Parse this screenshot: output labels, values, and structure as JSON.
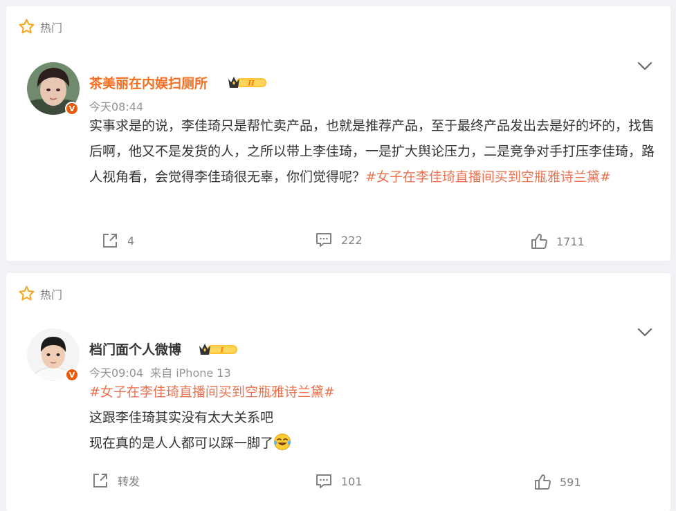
{
  "posts": [
    {
      "hot_label": "热门",
      "author": "茶美丽在内娱扫厕所",
      "level": "II",
      "time": "今天08:44",
      "source": "",
      "text_plain": "实事求是的说，李佳琦只是帮忙卖产品，也就是推荐产品，至于最终产品发出去是好的坏的，找售后啊，他又不是发货的人，之所以带上李佳琦，一是扩大舆论压力，二是竞争对手打压李佳琦，路人视角看，会觉得李佳琦很无辜，你们觉得呢？",
      "hashtag": "#女子在李佳琦直播间买到空瓶雅诗兰黛#",
      "repost": "4",
      "comments": "222",
      "likes": "1711"
    },
    {
      "hot_label": "热门",
      "author": "档门面个人微博",
      "level": "I",
      "time": "今天09:04",
      "source": "来自 iPhone 13",
      "hashtag": "#女子在李佳琦直播间买到空瓶雅诗兰黛#",
      "line1": "这跟李佳琦其实没有太大关系吧",
      "line2": "现在真的是人人都可以踩一脚了",
      "emoji": "crying-laughing-emoji",
      "repost": "转发",
      "comments": "101",
      "likes": "591"
    }
  ],
  "colors": {
    "background": "#f1f2f5",
    "hashtag": "#eb7350",
    "author1": "#f86d1e",
    "meta": "#939393",
    "badge": "#e65a0a",
    "star": "#f5a623"
  },
  "verified_badge": "V"
}
